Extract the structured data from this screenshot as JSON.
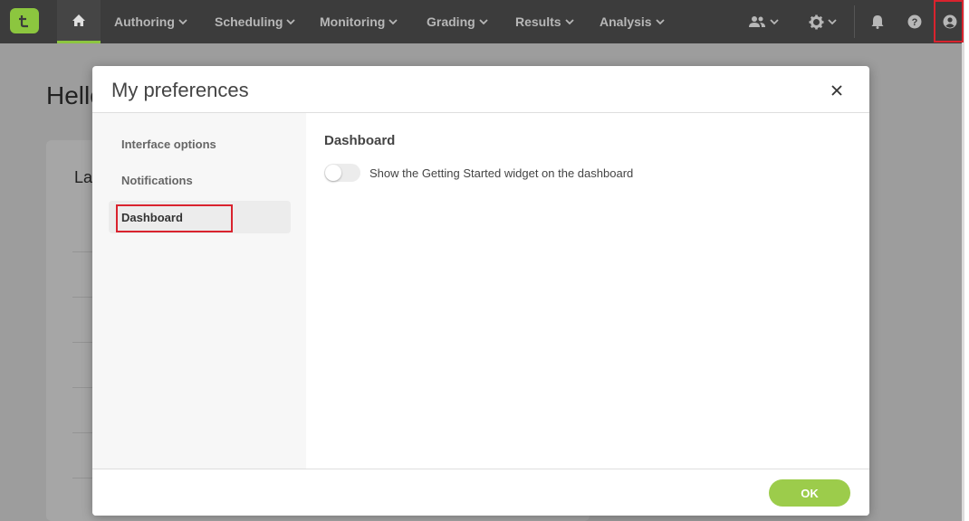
{
  "nav": {
    "home_icon": "home-icon",
    "items": [
      {
        "label": "Authoring"
      },
      {
        "label": "Scheduling"
      },
      {
        "label": "Monitoring"
      },
      {
        "label": "Grading"
      },
      {
        "label": "Results"
      },
      {
        "label": "Analysis"
      }
    ],
    "right_icons": [
      "users-icon",
      "gear-icon",
      "bell-icon",
      "help-icon",
      "user-account-icon"
    ]
  },
  "background": {
    "greeting": "Hello",
    "card_title": "La"
  },
  "modal": {
    "title": "My preferences",
    "sidebar": [
      {
        "label": "Interface options"
      },
      {
        "label": "Notifications"
      },
      {
        "label": "Dashboard",
        "active": true
      }
    ],
    "section_title": "Dashboard",
    "toggle": {
      "label": "Show the Getting Started widget on the dashboard",
      "on": false
    },
    "ok_label": "OK"
  },
  "colors": {
    "accent": "#8cc63f",
    "nav_bg": "#3c3c3c",
    "ok_button": "#9ccc4b",
    "highlight": "#d9232e"
  }
}
